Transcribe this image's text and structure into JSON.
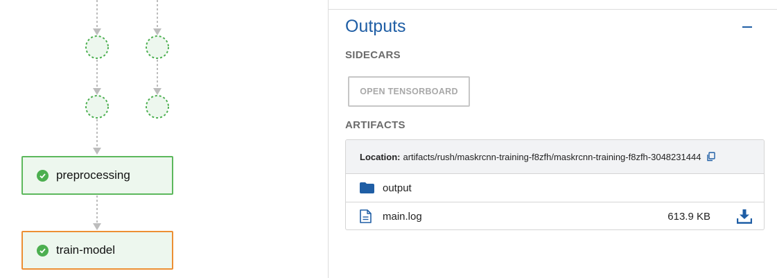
{
  "graph": {
    "nodes": [
      {
        "label": "preprocessing",
        "status": "succeeded",
        "selected": false
      },
      {
        "label": "train-model",
        "status": "succeeded",
        "selected": true
      }
    ]
  },
  "outputs": {
    "title": "Outputs",
    "collapse_icon": "minus-icon",
    "sidecars_heading": "SIDECARS",
    "tensorboard_button": "OPEN TENSORBOARD",
    "artifacts_heading": "ARTIFACTS",
    "location_label": "Location:",
    "location_path": "artifacts/rush/maskrcnn-training-f8zfh/maskrcnn-training-f8zfh-3048231444",
    "items": [
      {
        "name": "output",
        "type": "folder",
        "icon": "folder-icon",
        "size": ""
      },
      {
        "name": "main.log",
        "type": "file",
        "icon": "file-icon",
        "size": "613.9 KB"
      }
    ]
  },
  "colors": {
    "accent": "#1f5ea5",
    "success": "#4caf50",
    "node_border": "#5cb85c",
    "selected_border": "#ec8f33",
    "node_fill": "#edf7ee"
  }
}
